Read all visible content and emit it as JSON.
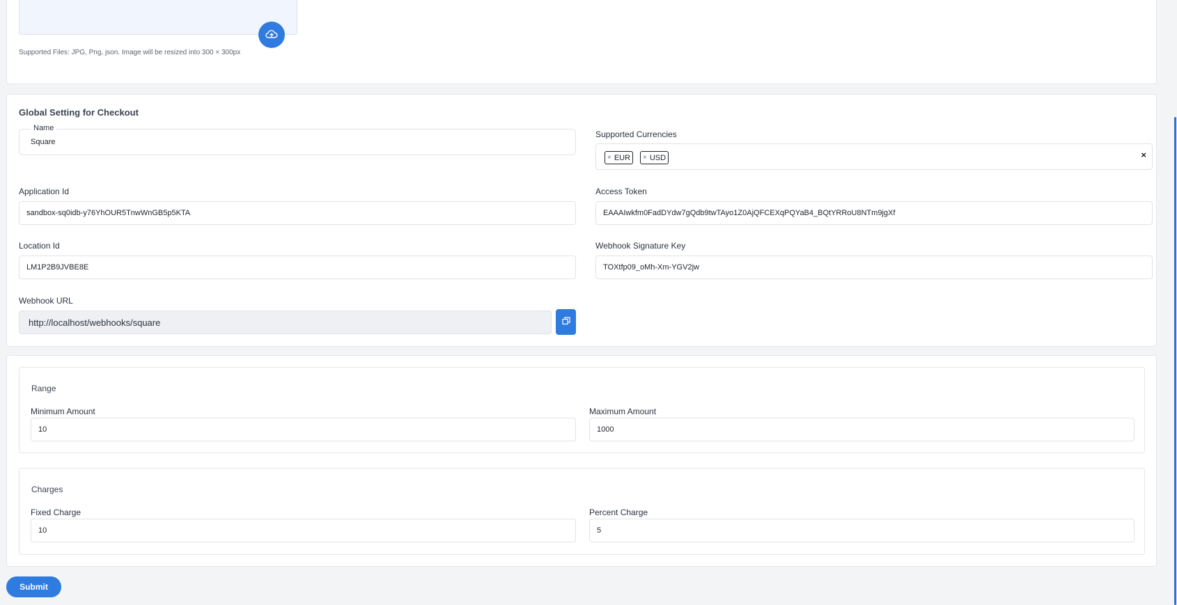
{
  "upload": {
    "hint": "Supported Files: JPG, Png, json. Image will be resized into 300 × 300px"
  },
  "global": {
    "title": "Global Setting for Checkout",
    "name": {
      "label": "Name",
      "value": "Square"
    },
    "currencies": {
      "label": "Supported Currencies",
      "tags": [
        "EUR",
        "USD"
      ],
      "remove_glyph": "×",
      "clear_glyph": "×"
    },
    "application_id": {
      "label": "Application Id",
      "value": "sandbox-sq0idb-y76YhOUR5TnwWnGB5p5KTA"
    },
    "access_token": {
      "label": "Access Token",
      "value": "EAAAIwkfm0FadDYdw7gQdb9twTAyo1Z0AjQFCEXqPQYaB4_BQtYRRoU8NTm9jgXf"
    },
    "location_id": {
      "label": "Location Id",
      "value": "LM1P2B9JVBE8E"
    },
    "webhook_key": {
      "label": "Webhook Signature Key",
      "value": "TOXtfp09_oMh-Xm-YGV2jw"
    },
    "webhook_url": {
      "label": "Webhook URL",
      "value": "http://localhost/webhooks/square"
    }
  },
  "range": {
    "title": "Range",
    "min": {
      "label": "Minimum Amount",
      "value": "10"
    },
    "max": {
      "label": "Maximum Amount",
      "value": "1000"
    }
  },
  "charges": {
    "title": "Charges",
    "fixed": {
      "label": "Fixed Charge",
      "value": "10"
    },
    "percent": {
      "label": "Percent Charge",
      "value": "5"
    }
  },
  "actions": {
    "submit_label": "Submit"
  },
  "colors": {
    "accent": "#2f7be0",
    "background": "#f3f4f6"
  },
  "icons": {
    "upload": "cloud-upload-icon",
    "copy": "copy-icon"
  }
}
